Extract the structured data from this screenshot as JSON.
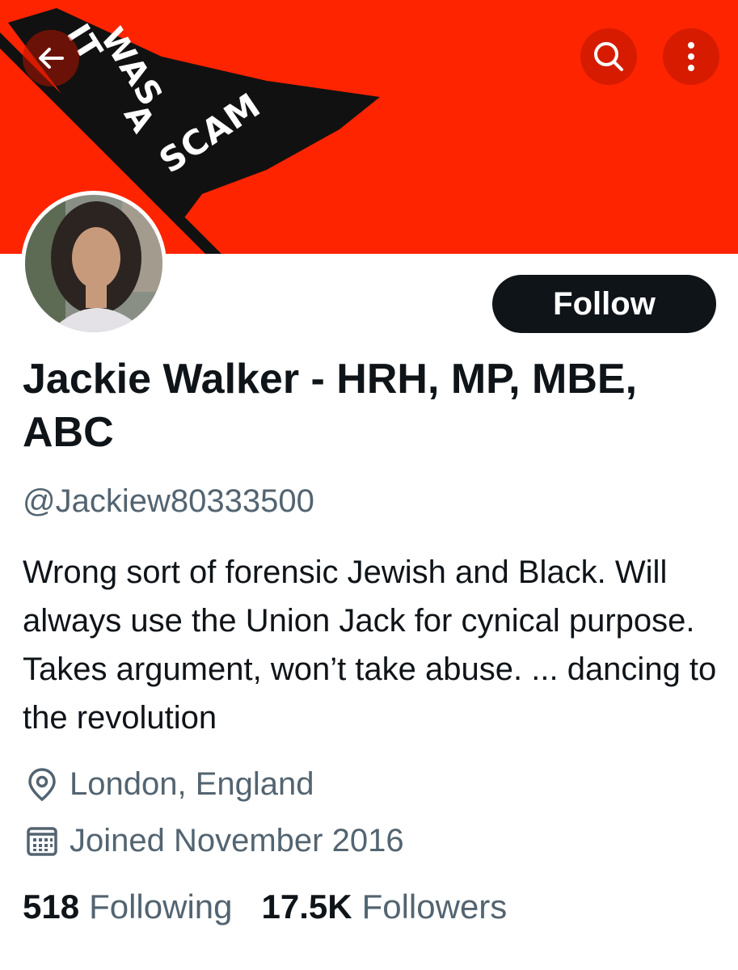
{
  "banner": {
    "flag_words": [
      "IT",
      "WAS",
      "A",
      "SCAM"
    ],
    "background_color": "#ff2400",
    "flag_color": "#111111"
  },
  "top_nav": {
    "back_icon": "arrow-left-icon",
    "search_icon": "search-icon",
    "more_icon": "more-vertical-icon"
  },
  "profile": {
    "display_name": "Jackie Walker - HRH, MP, MBE, ABC",
    "handle": "@Jackiew80333500",
    "follow_label": "Follow",
    "bio": "Wrong sort of forensic Jewish and Black. Will always use the Union Jack for cynical purpose. Takes argument, won’t take abuse. ... dancing to the revolution",
    "location": "London, England",
    "joined": "Joined November 2016"
  },
  "stats": {
    "following_count": "518",
    "following_label": "Following",
    "followers_count": "17.5K",
    "followers_label": "Followers"
  },
  "colors": {
    "text_primary": "#0f1419",
    "text_secondary": "#536471",
    "follow_button_bg": "#0f1419"
  }
}
